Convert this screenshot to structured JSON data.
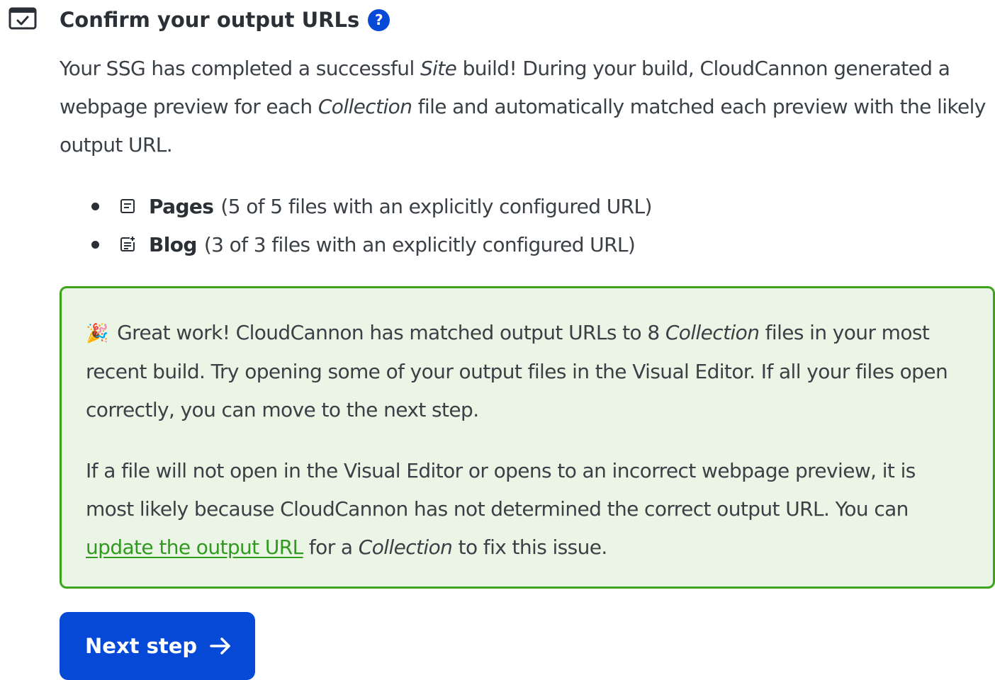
{
  "heading": {
    "title": "Confirm your output URLs",
    "help_glyph": "?"
  },
  "intro": {
    "text_1": "Your SSG has completed a successful ",
    "em_1": "Site",
    "text_2": " build! During your build, CloudCannon generated a webpage preview for each ",
    "em_2": "Collection",
    "text_3": " file and automatically matched each preview with the likely output URL."
  },
  "collections": [
    {
      "icon": "page-icon",
      "name": "Pages",
      "detail": "(5 of 5 files with an explicitly configured URL)"
    },
    {
      "icon": "blog-post-icon",
      "name": "Blog",
      "detail": "(3 of 3 files with an explicitly configured URL)"
    }
  ],
  "success_box": {
    "emoji": "🎉",
    "p1_text_1": " Great work! CloudCannon has matched output URLs to 8 ",
    "p1_em": "Collection",
    "p1_text_2": " files in your most recent build. Try opening some of your output files in the Visual Editor. If all your files open correctly, you can move to the next step.",
    "p2_text_1": "If a file will not open in the Visual Editor or opens to an incorrect webpage preview, it is most likely because CloudCannon has not determined the correct output URL. You can ",
    "p2_link": "update the output URL",
    "p2_text_2": " for a ",
    "p2_em": "Collection",
    "p2_text_3": " to fix this issue."
  },
  "next_button": {
    "label": "Next step",
    "icon": "arrow-right-icon"
  },
  "colors": {
    "primary": "#0649d6",
    "success_border": "#3ea21c",
    "success_bg": "#eaf5e6",
    "link": "#2f9a1d",
    "text": "#3a4046"
  }
}
